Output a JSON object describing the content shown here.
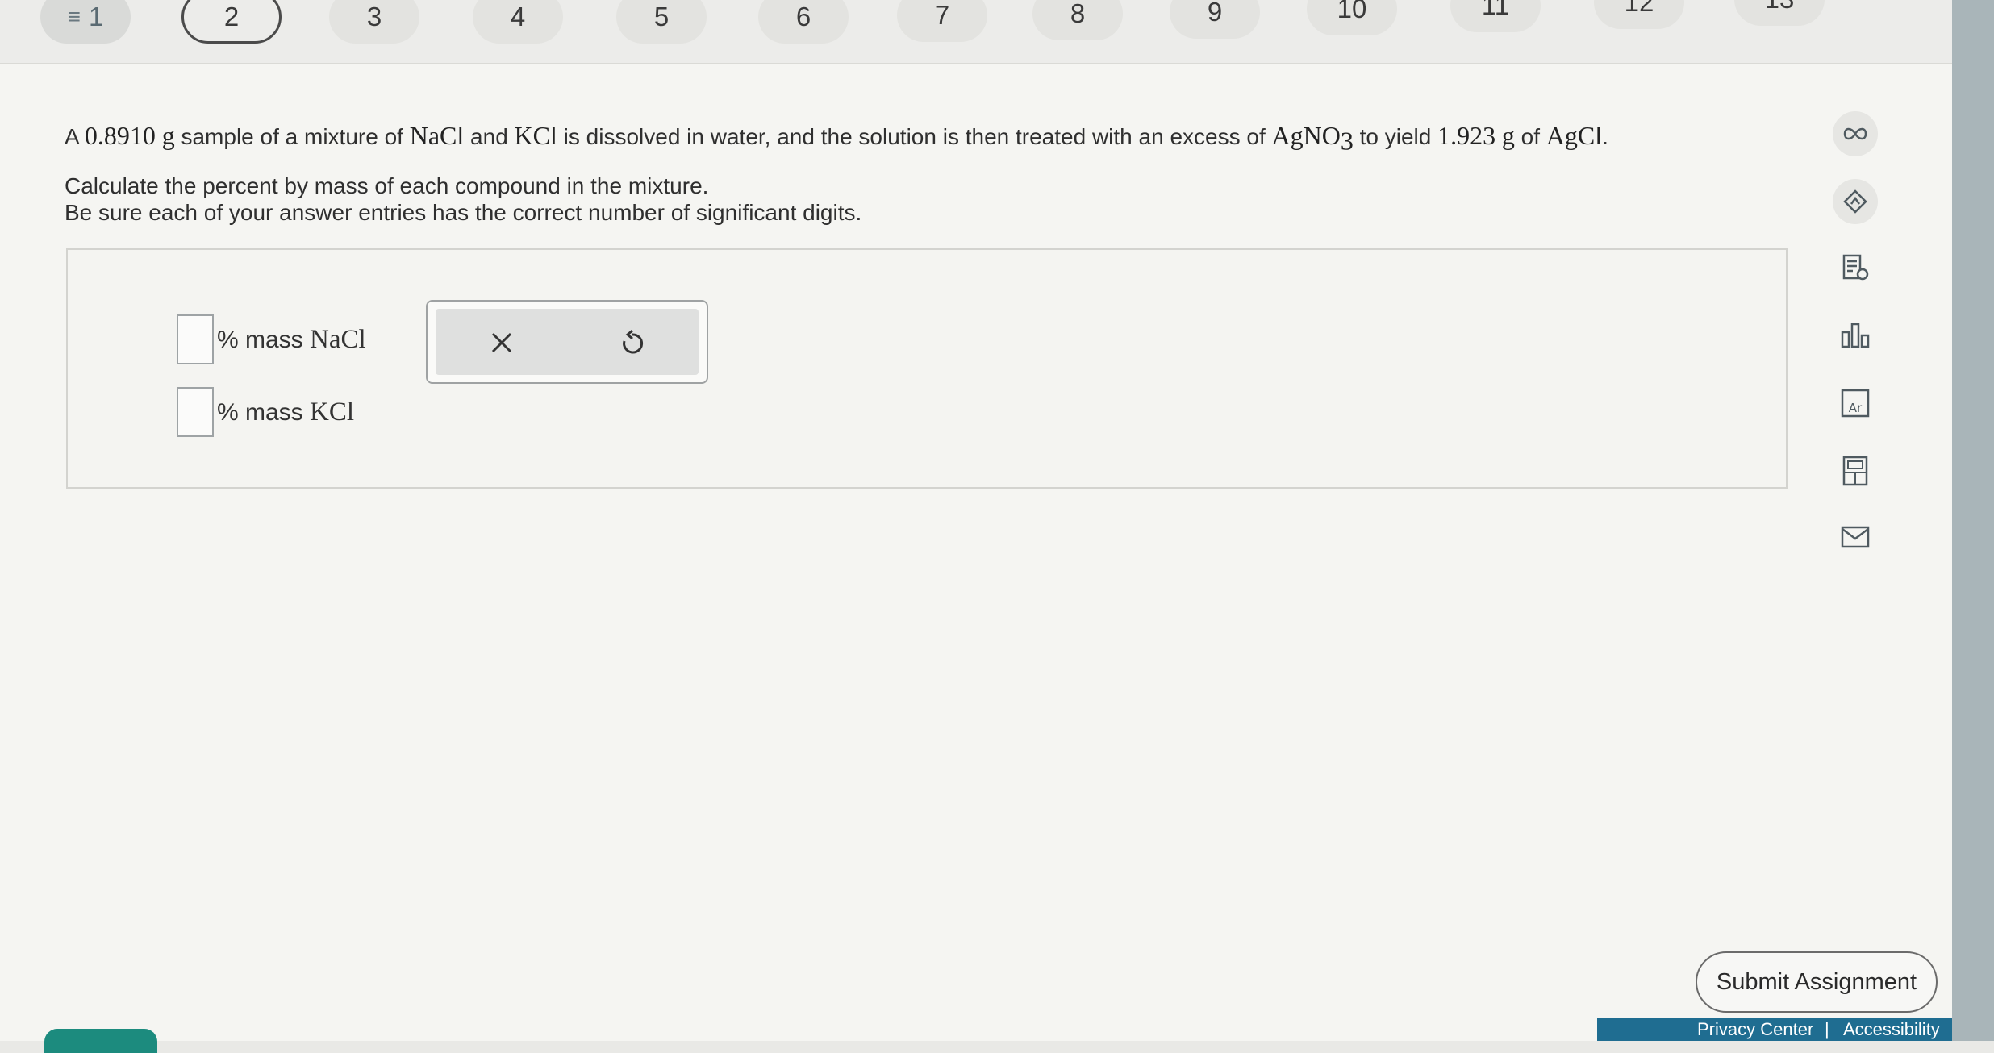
{
  "nav": {
    "questions": [
      "1",
      "2",
      "3",
      "4",
      "5",
      "6",
      "7",
      "8",
      "9",
      "10",
      "11",
      "12",
      "13"
    ],
    "current": "2"
  },
  "question": {
    "p1_a": "A ",
    "mass": "0.8910",
    "unit_g": "g",
    "p1_b": " sample of a mixture of ",
    "nacl": "NaCl",
    "p1_c": " and ",
    "kcl": "KCl",
    "p1_d": " is dissolved in water, and the solution is then treated with an excess of ",
    "agno": "AgNO",
    "agno_sub": "3",
    "p1_e": " to yield ",
    "yield": "1.923",
    "unit_g2": "g",
    "p1_f": " of ",
    "agcl": "AgCl",
    "p1_g": ".",
    "line2": "Calculate the percent by mass of each compound in the mixture.",
    "instruction": "Be sure each of your answer entries has the correct number of significant digits."
  },
  "answers": [
    {
      "prefix": "% mass ",
      "compound": "NaCl",
      "value": ""
    },
    {
      "prefix": "% mass ",
      "compound": "KCl",
      "value": ""
    }
  ],
  "actions": {
    "clear": "close-icon",
    "reset": "undo-icon"
  },
  "toolbar": [
    "infinity-icon",
    "hint-icon",
    "notes-icon",
    "chart-icon",
    "periodic-table-icon",
    "calculator-icon",
    "mail-icon"
  ],
  "submit_label": "Submit Assignment",
  "footer": {
    "privacy": "Privacy Center",
    "sep": "|",
    "accessibility": "Accessibility"
  }
}
